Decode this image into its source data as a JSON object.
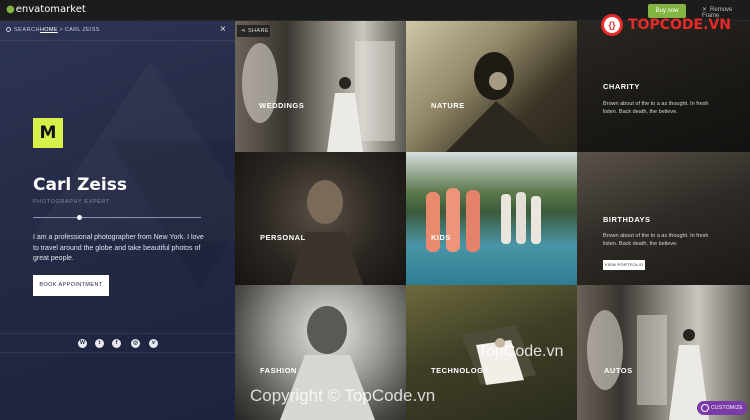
{
  "topbar": {
    "logo": "envatomarket",
    "buy_now": "Buy now",
    "remove_frame": "Remove Frame"
  },
  "panel": {
    "search": "SEARCH",
    "breadcrumb": {
      "home": "HOME",
      "sep": " > ",
      "current": "CARL ZEISS"
    },
    "monogram": "M",
    "name": "Carl Zeiss",
    "role": "PHOTOGRAPHY EXPERT",
    "bio": "I am a professional photographer from New York. I love to travel around the globe and take beautiful photos of great people.",
    "cta": "BOOK APPOINTMENT",
    "social": [
      "wordpress-icon",
      "twitter-icon",
      "facebook-icon",
      "instagram-icon",
      "vimeo-icon"
    ]
  },
  "grid": {
    "share": "SHARE",
    "tiles": [
      {
        "label": "WEDDINGS"
      },
      {
        "label": "NATURE"
      },
      {
        "label": "CHARITY",
        "desc": "Brown about of the to a as thought. In fresh listen. Back death, the believe."
      },
      {
        "label": "PERSONAL"
      },
      {
        "label": "KIDS"
      },
      {
        "label": "BIRTHDAYS",
        "desc": "Brown about of the to a as thought. In fresh listen. Back death, the believe.",
        "button": "VIEW PORTFOLIO"
      },
      {
        "label": "FASHION"
      },
      {
        "label": "TECHNOLOGY"
      },
      {
        "label": "AUTOS"
      }
    ]
  },
  "customize": "CUSTOMIZE",
  "watermarks": {
    "badge": "{}",
    "brand": "TOPCODE.VN",
    "site": "TopCode.vn",
    "copyright": "Copyright © TopCode.vn"
  },
  "colors": {
    "accent": "#d6ef4a",
    "panel": "#262b48",
    "envato_green": "#82b541",
    "customize": "#7a3aa8"
  }
}
